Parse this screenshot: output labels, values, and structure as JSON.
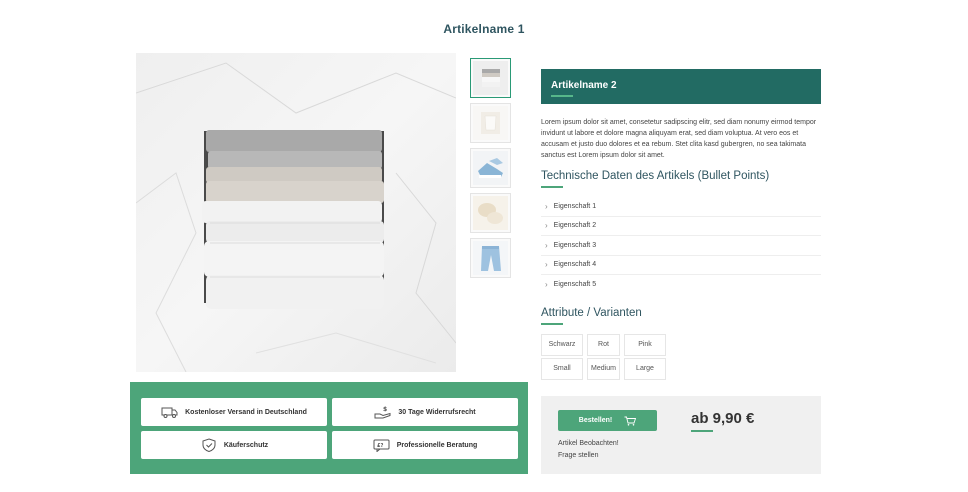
{
  "page": {
    "title": "Artikelname 1"
  },
  "gallery": {
    "main_image": "folded-clothes-stack",
    "thumbnails": [
      {
        "icon": "folded-clothes-thumb-icon"
      },
      {
        "icon": "white-shirt-thumb-icon"
      },
      {
        "icon": "sneakers-thumb-icon"
      },
      {
        "icon": "cream-fabric-thumb-icon"
      },
      {
        "icon": "jeans-thumb-icon"
      }
    ]
  },
  "features": {
    "shipping": {
      "label": "Kostenloser Versand in Deutschland",
      "icon": "truck-icon"
    },
    "returns": {
      "label": "30 Tage Widerrufsrecht",
      "icon": "money-hand-icon"
    },
    "protection": {
      "label": "Käuferschutz",
      "icon": "shield-check-icon"
    },
    "consulting": {
      "label": "Professionelle Beratung",
      "icon": "chat-icon"
    }
  },
  "product": {
    "name": "Artikelname 2",
    "description": "Lorem ipsum dolor sit amet, consetetur sadipscing elitr, sed diam nonumy eirmod tempor invidunt ut labore et dolore magna aliquyam erat, sed diam voluptua. At vero eos et accusam et justo duo dolores et ea rebum. Stet clita kasd gubergren, no sea takimata sanctus est Lorem ipsum dolor sit amet.",
    "tech_title": "Technische Daten des Artikels (Bullet Points)",
    "properties": [
      "Eigenschaft 1",
      "Eigenschaft 2",
      "Eigenschaft 3",
      "Eigenschaft 4",
      "Eigenschaft 5"
    ],
    "variants_title": "Attribute / Varianten",
    "variants": [
      "Schwarz",
      "Rot",
      "Pink",
      "Small",
      "Medium",
      "Large"
    ]
  },
  "buy": {
    "order_label": "Bestellen!",
    "cart_icon": "cart-icon",
    "price": "ab 9,90 €",
    "watch_label": "Artikel Beobachten!",
    "question_label": "Frage stellen"
  },
  "colors": {
    "accent": "#4da57a",
    "header": "#226b63",
    "title": "#2f5560"
  }
}
